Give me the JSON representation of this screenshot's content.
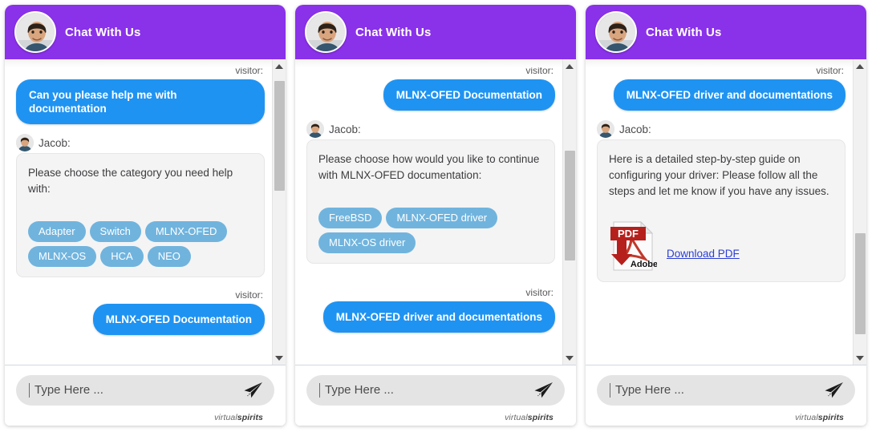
{
  "header": {
    "title": "Chat With Us",
    "avatar_icon": "agent-photo-avatar"
  },
  "composer": {
    "placeholder": "Type Here ...",
    "send_icon": "send-paper-plane-icon"
  },
  "footer": {
    "brand_light": "virtual",
    "brand_bold": "spirits"
  },
  "labels": {
    "visitor": "visitor:",
    "agent_name": "Jacob:"
  },
  "panels": [
    {
      "id": "panel-1",
      "scroll_thumb_top_pct": 4,
      "scroll_thumb_height_pct": 38,
      "visitor_top": "Can you please help me with documentation",
      "agent_text": "Please choose the category you need help with:",
      "chips": [
        "Adapter",
        "Switch",
        "MLNX-OFED",
        "MLNX-OS",
        "HCA",
        "NEO"
      ],
      "visitor_bottom": "MLNX-OFED Documentation"
    },
    {
      "id": "panel-2",
      "scroll_thumb_top_pct": 28,
      "scroll_thumb_height_pct": 38,
      "visitor_top": "MLNX-OFED Documentation",
      "agent_text": "Please choose how would you like to continue with MLNX-OFED documentation:",
      "chips": [
        "FreeBSD",
        "MLNX-OFED driver",
        "MLNX-OS driver"
      ],
      "visitor_bottom": "MLNX-OFED driver and documentations"
    },
    {
      "id": "panel-3",
      "scroll_thumb_top_pct": 55,
      "scroll_thumb_height_pct": 38,
      "visitor_top": "MLNX-OFED driver and documentations",
      "agent_text": "Here is a detailed step-by-step guide on configuring your driver: Please follow all the steps and let me know if you have any issues.",
      "attachment": {
        "icon": "adobe-pdf-download-icon",
        "icon_label_top": "PDF",
        "icon_label_bottom": "Adobe",
        "link_text": "Download PDF"
      }
    }
  ],
  "colors": {
    "header_purple": "#8a31ea",
    "visitor_blue": "#1f93f2",
    "chip_blue": "#70b4de",
    "agent_bubble": "#f4f4f4",
    "link_blue": "#2c3ed1",
    "pdf_red": "#b5201d"
  }
}
